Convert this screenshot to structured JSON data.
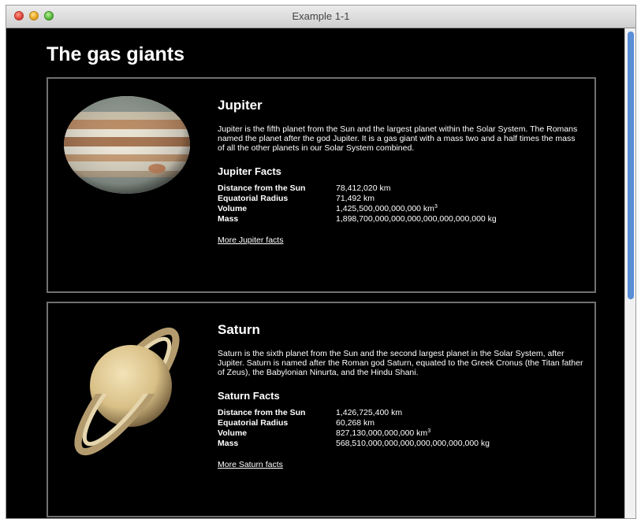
{
  "window": {
    "title": "Example 1-1"
  },
  "page": {
    "heading": "The gas giants"
  },
  "planets": [
    {
      "name": "Jupiter",
      "description": "Jupiter is the fifth planet from the Sun and the largest planet within the Solar System. The Romans named the planet after the god Jupiter. It is a gas giant with a mass two and a half times the mass of all the other planets in our Solar System combined.",
      "facts_heading": "Jupiter Facts",
      "facts": [
        {
          "label": "Distance from the Sun",
          "value": "78,412,020 km",
          "sup": ""
        },
        {
          "label": "Equatorial Radius",
          "value": "71,492 km",
          "sup": ""
        },
        {
          "label": "Volume",
          "value": "1,425,500,000,000,000 km",
          "sup": "3"
        },
        {
          "label": "Mass",
          "value": "1,898,700,000,000,000,000,000,000,000 kg",
          "sup": ""
        }
      ],
      "more_link": "More Jupiter facts"
    },
    {
      "name": "Saturn",
      "description": "Saturn is the sixth planet from the Sun and the second largest planet in the Solar System, after Jupiter. Saturn is named after the Roman god Saturn, equated to the Greek Cronus (the Titan father of Zeus), the Babylonian Ninurta, and the Hindu Shani.",
      "facts_heading": "Saturn Facts",
      "facts": [
        {
          "label": "Distance from the Sun",
          "value": "1,426,725,400 km",
          "sup": ""
        },
        {
          "label": "Equatorial Radius",
          "value": "60,268 km",
          "sup": ""
        },
        {
          "label": "Volume",
          "value": "827,130,000,000,000 km",
          "sup": "3"
        },
        {
          "label": "Mass",
          "value": "568,510,000,000,000,000,000,000,000 kg",
          "sup": ""
        }
      ],
      "more_link": "More Saturn facts"
    }
  ]
}
